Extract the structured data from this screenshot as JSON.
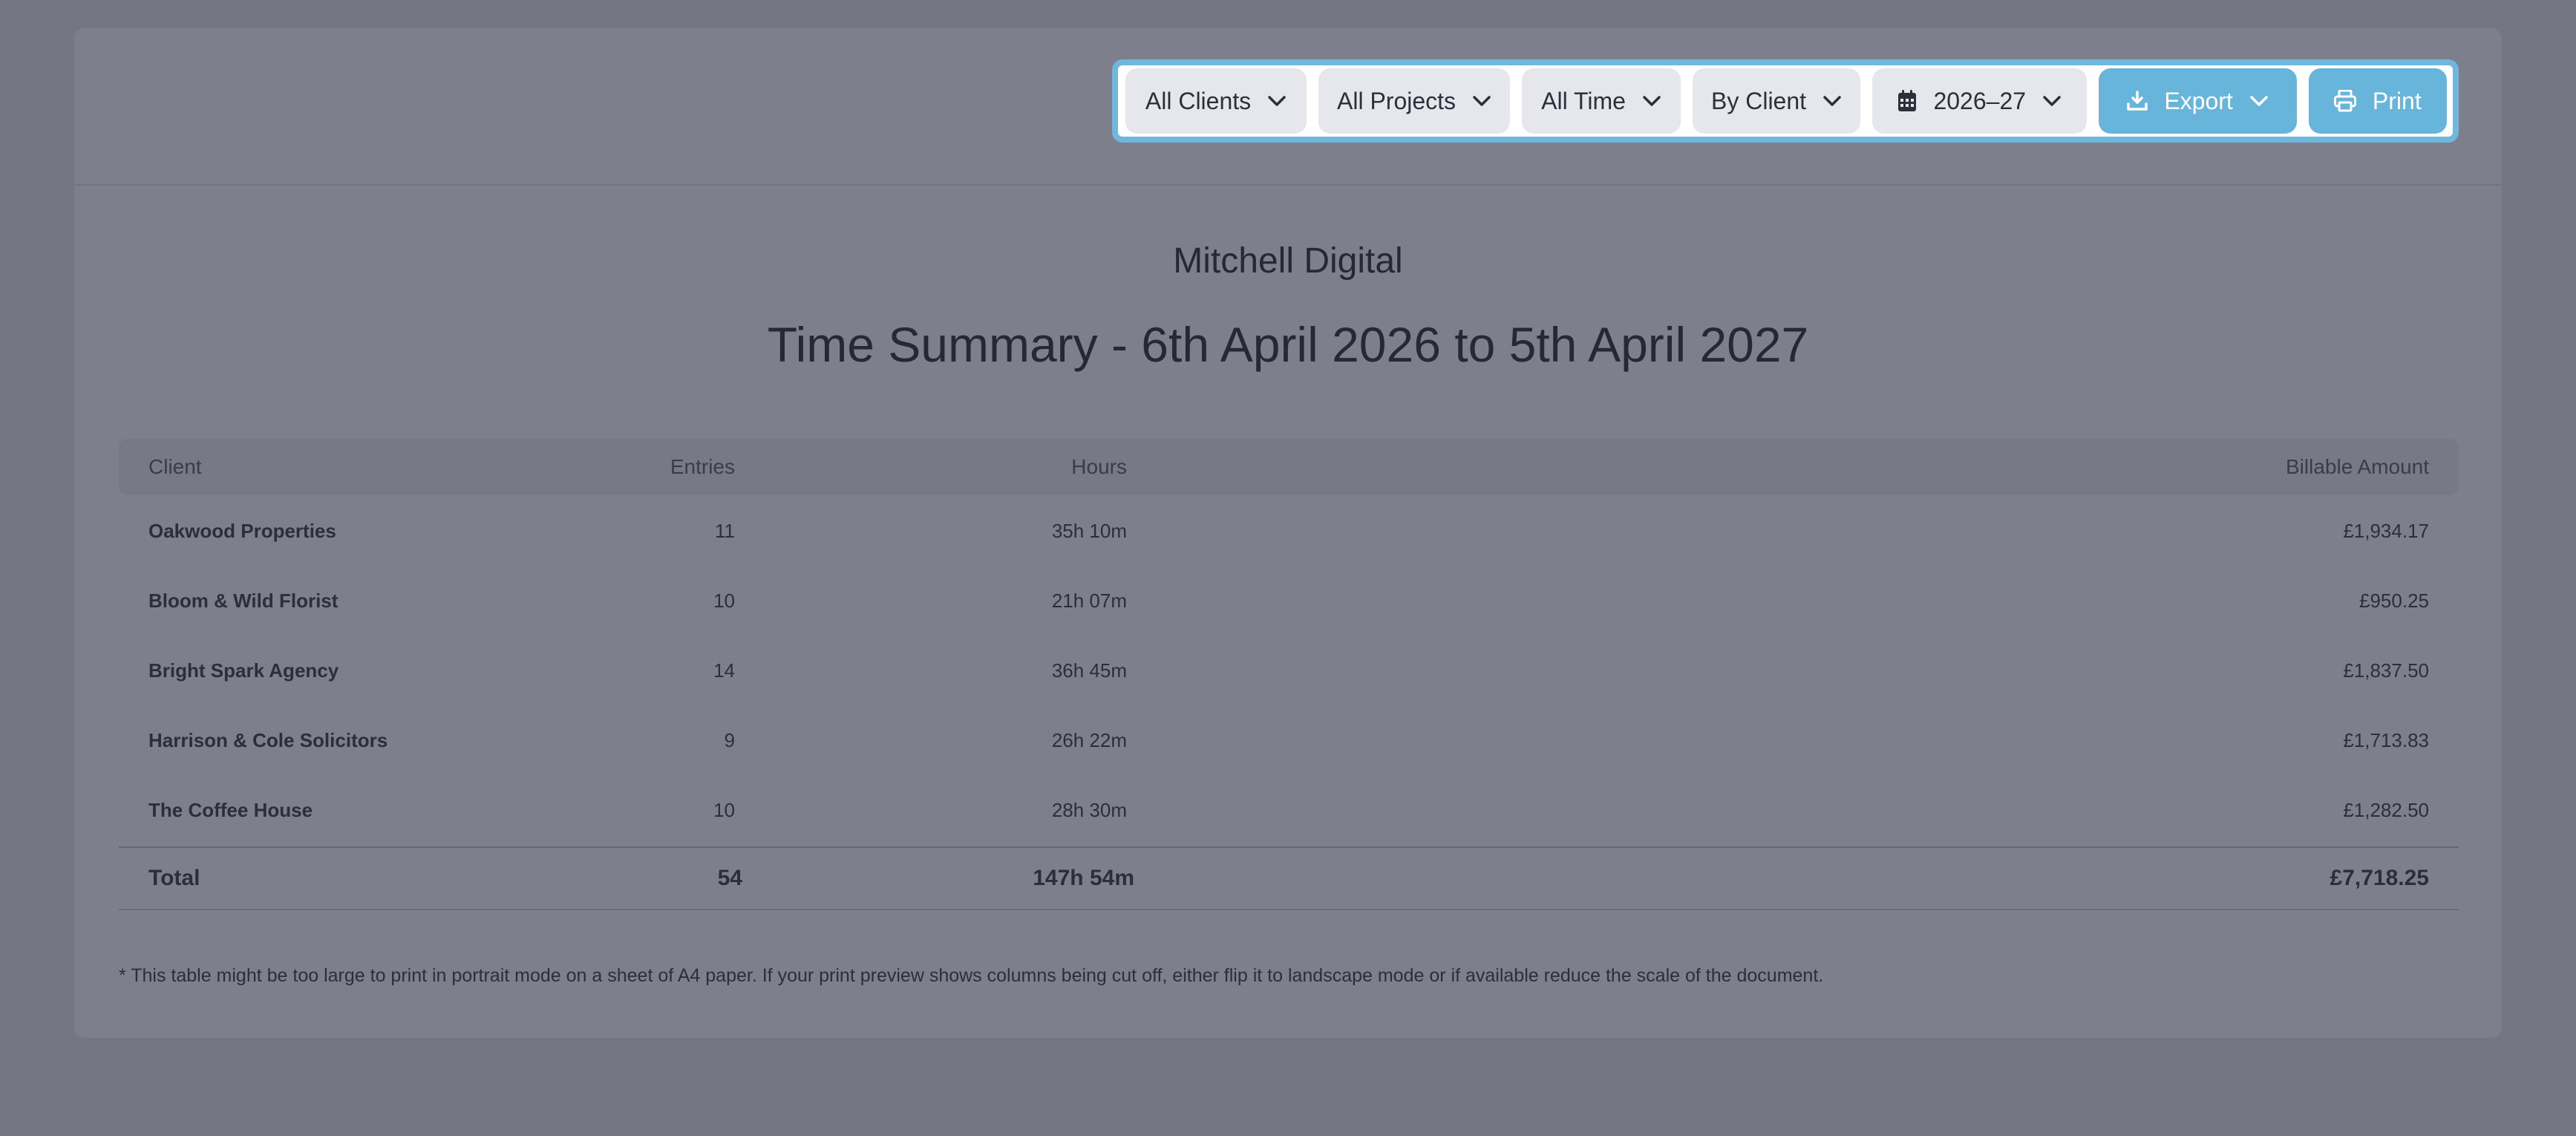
{
  "toolbar": {
    "clients_label": "All Clients",
    "projects_label": "All Projects",
    "time_label": "All Time",
    "group_label": "By Client",
    "year_label": "2026–27",
    "export_label": "Export",
    "print_label": "Print"
  },
  "report": {
    "company": "Mitchell Digital",
    "title": "Time Summary - 6th April 2026 to 5th April 2027"
  },
  "table": {
    "headers": {
      "client": "Client",
      "entries": "Entries",
      "hours": "Hours",
      "amount": "Billable Amount"
    },
    "rows": [
      {
        "client": "Oakwood Properties",
        "entries": "11",
        "hours": "35h 10m",
        "amount": "£1,934.17"
      },
      {
        "client": "Bloom & Wild Florist",
        "entries": "10",
        "hours": "21h 07m",
        "amount": "£950.25"
      },
      {
        "client": "Bright Spark Agency",
        "entries": "14",
        "hours": "36h 45m",
        "amount": "£1,837.50"
      },
      {
        "client": "Harrison & Cole Solicitors",
        "entries": "9",
        "hours": "26h 22m",
        "amount": "£1,713.83"
      },
      {
        "client": "The Coffee House",
        "entries": "10",
        "hours": "28h 30m",
        "amount": "£1,282.50"
      }
    ],
    "total": {
      "label": "Total",
      "entries": "54",
      "hours": "147h 54m",
      "amount": "£7,718.25"
    }
  },
  "footnote": "* This table might be too large to print in portrait mode on a sheet of A4 paper. If your print preview shows columns being cut off, either flip it to landscape mode or if available reduce the scale of the document.",
  "icons": {
    "dropdown": "chevron-down-icon",
    "calendar": "calendar-icon",
    "export": "download-icon",
    "print": "printer-icon"
  },
  "colors": {
    "accent": "#67b5da",
    "toolbar_border": "#6fb7dc",
    "button_grey": "#e5e7ec",
    "background": "#747683",
    "card": "#7d7f8c"
  }
}
